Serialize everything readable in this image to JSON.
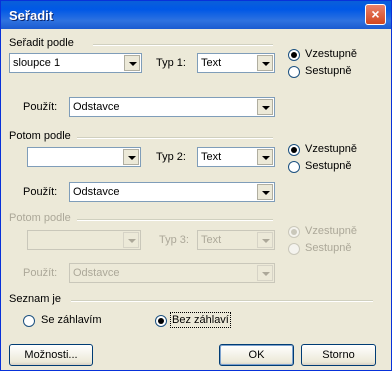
{
  "window": {
    "title": "Seřadit",
    "close_glyph": "×"
  },
  "groups": [
    {
      "label": "Seřadit podle",
      "field": "sloupce 1",
      "type_label": "Typ 1:",
      "type_value": "Text",
      "use_label": "Použít:",
      "use_value": "Odstavce",
      "asc": "Vzestupně",
      "desc": "Sestupně",
      "selected": "asc",
      "enabled": true
    },
    {
      "label": "Potom podle",
      "field": "",
      "type_label": "Typ 2:",
      "type_value": "Text",
      "use_label": "Použít:",
      "use_value": "Odstavce",
      "asc": "Vzestupně",
      "desc": "Sestupně",
      "selected": "asc",
      "enabled": true
    },
    {
      "label": "Potom podle",
      "field": "",
      "type_label": "Typ 3:",
      "type_value": "Text",
      "use_label": "Použít:",
      "use_value": "Odstavce",
      "asc": "Vzestupně",
      "desc": "Sestupně",
      "selected": "asc",
      "enabled": false
    }
  ],
  "list": {
    "label": "Seznam je",
    "with_header": "Se záhlavím",
    "without_header": "Bez záhlaví",
    "selected": "without_header"
  },
  "buttons": {
    "options": "Možnosti...",
    "ok": "OK",
    "cancel": "Storno"
  }
}
